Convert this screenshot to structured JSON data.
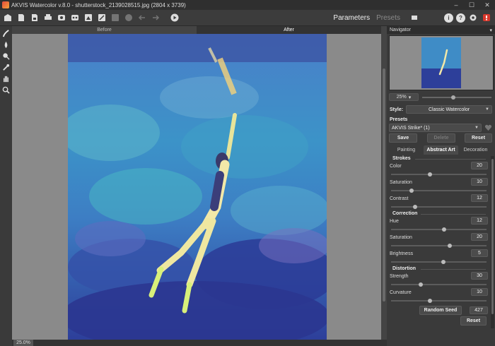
{
  "window": {
    "title": "AKVIS Watercolor v.8.0 - shutterstock_2139028515.jpg (2804 x 3739)",
    "minimize": "–",
    "maximize": "☐",
    "close": "✕"
  },
  "toolbar": {
    "tabs": [
      {
        "label": "Parameters",
        "active": true
      },
      {
        "label": "Presets",
        "active": false
      }
    ],
    "info_glyph": "i",
    "help_glyph": "?",
    "colors": {
      "info": "#e0e0e0",
      "help": "#e0e0e0",
      "notify": "#d9382c"
    }
  },
  "canvas": {
    "before_label": "Before",
    "after_label": "After",
    "zoom_readout": "25.0%"
  },
  "panel": {
    "navigator_title": "Navigator",
    "navigator_menu_glyph": "▾",
    "zoom_value": "25%",
    "zoom_slider_fraction": 0.45,
    "style_label": "Style:",
    "style_value": "Classic Watercolor",
    "presets_label": "Presets",
    "preset_value": "AKVIS Strike* (1)",
    "save_label": "Save",
    "delete_label": "Delete",
    "reset_label": "Reset",
    "tabs": [
      {
        "label": "Painting",
        "active": false
      },
      {
        "label": "Abstract Art",
        "active": true
      },
      {
        "label": "Decoration",
        "active": false
      }
    ],
    "sections": {
      "strokes": "Strokes",
      "correction": "Correction",
      "distortion": "Distortion"
    },
    "params": {
      "color": {
        "label": "Color",
        "value": "20",
        "fraction": 0.4
      },
      "saturation1": {
        "label": "Saturation",
        "value": "10",
        "fraction": 0.2
      },
      "contrast": {
        "label": "Contrast",
        "value": "12",
        "fraction": 0.24
      },
      "hue": {
        "label": "Hue",
        "value": "12",
        "fraction": 0.56
      },
      "saturation2": {
        "label": "Saturation",
        "value": "20",
        "fraction": 0.62
      },
      "brightness": {
        "label": "Brightness",
        "value": "5",
        "fraction": 0.55
      },
      "strength": {
        "label": "Strength",
        "value": "30",
        "fraction": 0.3
      },
      "curvature": {
        "label": "Curvature",
        "value": "10",
        "fraction": 0.4
      }
    },
    "random_seed_label": "Random Seed",
    "random_seed_value": "427",
    "bottom_reset_label": "Reset"
  }
}
